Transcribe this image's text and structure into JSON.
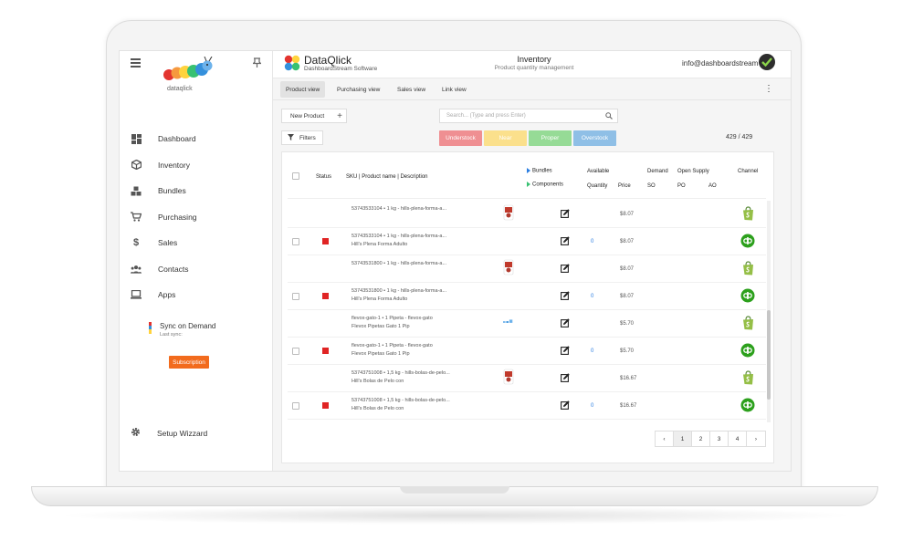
{
  "sidebar": {
    "logo_text": "dataqlick",
    "items": [
      {
        "label": "Dashboard",
        "icon": "dashboard-icon"
      },
      {
        "label": "Inventory",
        "icon": "box-icon"
      },
      {
        "label": "Bundles",
        "icon": "bundles-icon"
      },
      {
        "label": "Purchasing",
        "icon": "cart-icon"
      },
      {
        "label": "Sales",
        "icon": "dollar-icon"
      },
      {
        "label": "Contacts",
        "icon": "contacts-icon"
      },
      {
        "label": "Apps",
        "icon": "laptop-icon"
      }
    ],
    "sync_label": "Sync on Demand",
    "sync_sub": "Last sync:",
    "subscription_label": "Subscription",
    "setup_label": "Setup Wizzard"
  },
  "header": {
    "brand_name": "DataQlick",
    "brand_sub": "DashboardStream Software",
    "page_title": "Inventory",
    "page_subtitle": "Product quantity management",
    "user_email": "info@dashboardstream"
  },
  "tabs": [
    {
      "label": "Product view",
      "active": true
    },
    {
      "label": "Purchasing view",
      "active": false
    },
    {
      "label": "Sales view",
      "active": false
    },
    {
      "label": "Link view",
      "active": false
    }
  ],
  "toolbar": {
    "new_product_label": "New Product",
    "search_placeholder": "Search... (Type and press Enter)",
    "filters_label": "Filters",
    "status_buttons": [
      {
        "label": "Understock",
        "color": "#ef8f92"
      },
      {
        "label": "Near",
        "color": "#fbe08c"
      },
      {
        "label": "Proper",
        "color": "#96db96"
      },
      {
        "label": "Overstock",
        "color": "#8fbfe6"
      }
    ],
    "count": "429 / 429"
  },
  "table": {
    "headers": {
      "status": "Status",
      "sku": "SKU | Product name | Description",
      "bundles": "Bundles",
      "components": "Components",
      "available": "Available",
      "quantity": "Quantity",
      "price": "Price",
      "demand": "Demand",
      "so": "SO",
      "open_supply": "Open Supply",
      "po": "PO",
      "ao": "AO",
      "channel": "Channel"
    },
    "rows": [
      {
        "sku": "53743533104 • 1 kg - hills-plena-forma-a...",
        "name": "",
        "qty": "",
        "price": "$8.07",
        "channel": "shopify",
        "parent": true,
        "thumb": "bag"
      },
      {
        "sku": "53743533104 • 1 kg - hills-plena-forma-a...",
        "name": "Hill's Plena Forma Adulto",
        "qty": "0",
        "price": "$8.07",
        "channel": "quickbooks",
        "parent": false,
        "thumb": ""
      },
      {
        "sku": "53743531800 • 1 kg - hills-plena-forma-a...",
        "name": "",
        "qty": "",
        "price": "$8.07",
        "channel": "shopify",
        "parent": true,
        "thumb": "bag"
      },
      {
        "sku": "53743531800 • 1 kg - hills-plena-forma-a...",
        "name": "Hill's Plena Forma Adulto",
        "qty": "0",
        "price": "$8.07",
        "channel": "quickbooks",
        "parent": false,
        "thumb": ""
      },
      {
        "sku": "flevox-gato-1 • 1 Pipeta - flevox-gato",
        "name": "Flevox Pipetas Gato 1 Pip",
        "qty": "",
        "price": "$5.70",
        "channel": "shopify",
        "parent": true,
        "thumb": "pipette"
      },
      {
        "sku": "flevox-gato-1 • 1 Pipeta - flevox-gato",
        "name": "Flevox Pipetas Gato 1 Pip",
        "qty": "0",
        "price": "$5.70",
        "channel": "quickbooks",
        "parent": false,
        "thumb": ""
      },
      {
        "sku": "53743751008 • 1,5 kg - hills-bolas-de-pelo...",
        "name": "Hill's Bolas de Pelo con",
        "qty": "",
        "price": "$16.67",
        "channel": "shopify",
        "parent": true,
        "thumb": "bag"
      },
      {
        "sku": "53743751008 • 1,5 kg - hills-bolas-de-pelo...",
        "name": "Hill's Bolas de Pelo con",
        "qty": "0",
        "price": "$16.67",
        "channel": "quickbooks",
        "parent": false,
        "thumb": ""
      }
    ]
  },
  "pagination": {
    "prev": "‹",
    "pages": [
      "1",
      "2",
      "3",
      "4"
    ],
    "next": "›",
    "current": "1"
  },
  "colors": {
    "status_red": "#e02424",
    "qty_blue": "#2a7de1",
    "shopify_green": "#95bf47",
    "quickbooks_green": "#2ca01c",
    "subscription_orange": "#f26b1d"
  }
}
